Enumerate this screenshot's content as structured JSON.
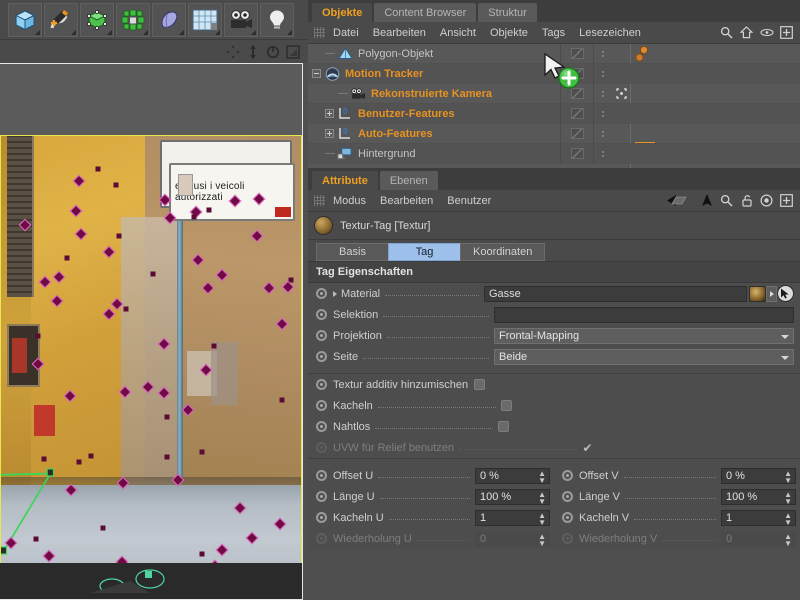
{
  "toolbar": {
    "buttons": [
      {
        "name": "cube-tool-icon",
        "label": "Würfel"
      },
      {
        "name": "spline-pen-icon",
        "label": "Spline"
      },
      {
        "name": "nurbs-icon",
        "label": "NURBS"
      },
      {
        "name": "array-icon",
        "label": "Array"
      },
      {
        "name": "deformer-icon",
        "label": "Deformer"
      },
      {
        "name": "environment-icon",
        "label": "Umgebung"
      },
      {
        "name": "camera-icon",
        "label": "Kamera"
      },
      {
        "name": "light-icon",
        "label": "Licht"
      }
    ],
    "view_icons": [
      "move-icon",
      "scale-icon",
      "rotate-icon",
      "render-view-icon"
    ]
  },
  "object_manager": {
    "tabs": [
      {
        "label": "Objekte",
        "active": true
      },
      {
        "label": "Content Browser",
        "active": false
      },
      {
        "label": "Struktur",
        "active": false
      }
    ],
    "menu": [
      "Datei",
      "Bearbeiten",
      "Ansicht",
      "Objekte",
      "Tags",
      "Lesezeichen"
    ],
    "menu_icons": [
      "search-icon",
      "home-icon",
      "eye-icon",
      "plus-box-icon"
    ],
    "rows": [
      {
        "label": "Polygon-Objekt",
        "color": "gray",
        "indent": 1,
        "icon": "polygon-object-icon",
        "expander": "none",
        "tags": "spheres",
        "extra": ""
      },
      {
        "label": "Motion Tracker",
        "color": "orange",
        "indent": 0,
        "icon": "motion-tracker-icon",
        "expander": "minus",
        "tags": "tracker",
        "extra": ""
      },
      {
        "label": "Rekonstruierte Kamera",
        "color": "orange",
        "indent": 2,
        "icon": "camera-object-icon",
        "expander": "none",
        "tags": "",
        "extra": "target-icon"
      },
      {
        "label": "Benutzer-Features",
        "color": "orange",
        "indent": 1,
        "icon": "features-icon",
        "expander": "plus",
        "tags": "",
        "extra": ""
      },
      {
        "label": "Auto-Features",
        "color": "orange",
        "indent": 1,
        "icon": "features-icon",
        "expander": "plus",
        "tags": "",
        "extra": ""
      },
      {
        "label": "Hintergrund",
        "color": "gray",
        "indent": 1,
        "icon": "background-object-icon",
        "expander": "none",
        "tags": "texture",
        "extra": ""
      }
    ]
  },
  "attribute_manager": {
    "tabs": [
      {
        "label": "Attribute",
        "active": true
      },
      {
        "label": "Ebenen",
        "active": false
      }
    ],
    "menu": [
      "Modus",
      "Bearbeiten",
      "Benutzer"
    ],
    "menu_icons": [
      "back-arrow-icon",
      "up-arrow-icon",
      "search-icon",
      "lock-icon",
      "target-icon",
      "plus-box-icon"
    ],
    "title": "Textur-Tag [Textur]",
    "subtabs": [
      {
        "label": "Basis",
        "active": false
      },
      {
        "label": "Tag",
        "active": true
      },
      {
        "label": "Koordinaten",
        "active": false
      }
    ],
    "section_title": "Tag Eigenschaften",
    "properties": [
      {
        "label": "Material",
        "type": "material",
        "value": "Gasse",
        "expander": true
      },
      {
        "label": "Selektion",
        "type": "text",
        "value": ""
      },
      {
        "label": "Projektion",
        "type": "dropdown",
        "value": "Frontal-Mapping"
      },
      {
        "label": "Seite",
        "type": "dropdown",
        "value": "Beide"
      }
    ],
    "checkboxes": [
      {
        "label": "Textur additiv hinzumischen",
        "checked": false,
        "enabled": true,
        "dots": false
      },
      {
        "label": "Kacheln",
        "checked": false,
        "enabled": true,
        "dots": true
      },
      {
        "label": "Nahtlos",
        "checked": false,
        "enabled": true,
        "dots": true
      },
      {
        "label": "UVW für Relief benutzen",
        "checked": true,
        "enabled": false,
        "dots": true
      }
    ],
    "numeric_rows": [
      {
        "left_label": "Offset U",
        "left_value": "0 %",
        "left_enabled": true,
        "right_label": "Offset V",
        "right_value": "0 %",
        "right_enabled": true
      },
      {
        "left_label": "Länge U",
        "left_value": "100 %",
        "left_enabled": true,
        "right_label": "Länge V",
        "right_value": "100 %",
        "right_enabled": true
      },
      {
        "left_label": "Kacheln U",
        "left_value": "1",
        "left_enabled": true,
        "right_label": "Kacheln V",
        "right_value": "1",
        "right_enabled": true
      },
      {
        "left_label": "Wiederholung U",
        "left_value": "0",
        "left_enabled": false,
        "right_label": "Wiederholung V",
        "right_value": "0",
        "right_enabled": false
      }
    ]
  },
  "viewport": {
    "name": "perspective-viewport",
    "sign_line1": "esclusi i veicoli",
    "sign_line2": "autorizzati",
    "cursor": "drag-add-cursor"
  },
  "colors": {
    "accent_orange": "#e8921f",
    "tab_active_blue": "#9dc0ea",
    "panel_bg": "#4d4d4d",
    "tree_bg": "#585858",
    "marker_pink": "#e86fd0",
    "viewport_border": "#e8e84a"
  }
}
